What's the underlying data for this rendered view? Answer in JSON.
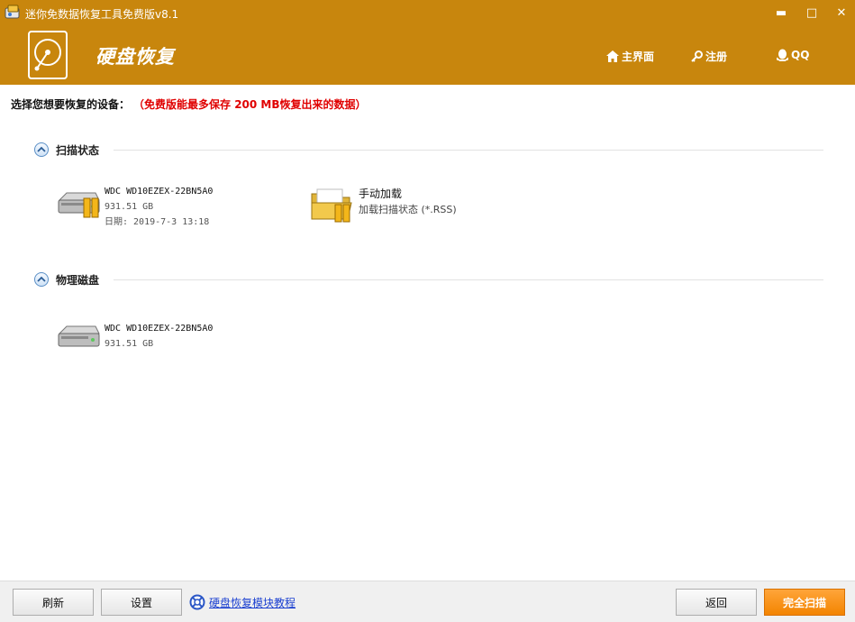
{
  "window": {
    "title": "迷你免数据恢复工具免费版v8.1",
    "minimize": "▬",
    "maximize": "□",
    "close": "✕"
  },
  "header": {
    "module_title": "硬盘恢复",
    "nav": [
      {
        "label": "主界面",
        "icon": "home-icon"
      },
      {
        "label": "注册",
        "icon": "key-icon"
      },
      {
        "label": "QQ",
        "icon": "qq-penguin-icon"
      }
    ]
  },
  "prompt": {
    "label": "选择您想要恢复的设备：",
    "note": "（免费版能最多保存 200 MB恢复出来的数据）"
  },
  "sections": {
    "scan_status": {
      "title": "扫描状态",
      "devices": [
        {
          "name": "WDC WD10EZEX-22BN5A0",
          "size": "931.51 GB",
          "date": "日期: 2019-7-3 13:18"
        }
      ],
      "manual": {
        "title": "手动加载",
        "subtitle": "加载扫描状态 (*.RSS)"
      }
    },
    "physical_disks": {
      "title": "物理磁盘",
      "devices": [
        {
          "name": "WDC WD10EZEX-22BN5A0",
          "size": "931.51 GB"
        }
      ]
    }
  },
  "footer": {
    "refresh": "刷新",
    "settings": "设置",
    "tutorial": "硬盘恢复模块教程",
    "back": "返回",
    "scan": "完全扫描"
  },
  "colors": {
    "header": "#c8860d",
    "note": "#e00000",
    "scan_button": "#f38400",
    "link": "#1a3fd0"
  }
}
